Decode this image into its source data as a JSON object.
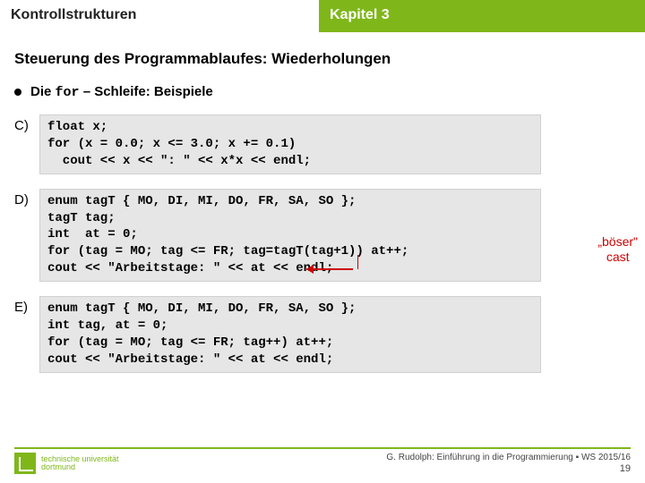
{
  "header": {
    "left": "Kontrollstrukturen",
    "right": "Kapitel 3"
  },
  "section_title": "Steuerung des Programmablaufes: Wiederholungen",
  "bullet": {
    "prefix": "Die ",
    "keyword": "for",
    "suffix": " – Schleife: Beispiele"
  },
  "examples": {
    "c": {
      "label": "C)",
      "code": "float x;\nfor (x = 0.0; x <= 3.0; x += 0.1)\n  cout << x << \": \" << x*x << endl;"
    },
    "d": {
      "label": "D)",
      "code": "enum tagT { MO, DI, MI, DO, FR, SA, SO };\ntagT tag;\nint  at = 0;\nfor (tag = MO; tag <= FR; tag=tagT(tag+1)) at++;\ncout << \"Arbeitstage: \" << at << endl;"
    },
    "e": {
      "label": "E)",
      "code": "enum tagT { MO, DI, MI, DO, FR, SA, SO };\nint tag, at = 0;\nfor (tag = MO; tag <= FR; tag++) at++;\ncout << \"Arbeitstage: \" << at << endl;"
    }
  },
  "annotation": {
    "line1": "„böser\"",
    "line2": "cast"
  },
  "footer": {
    "uni_line1": "technische universität",
    "uni_line2": "dortmund",
    "credit": "G. Rudolph: Einführung in die Programmierung ▪ WS 2015/16",
    "page": "19"
  }
}
